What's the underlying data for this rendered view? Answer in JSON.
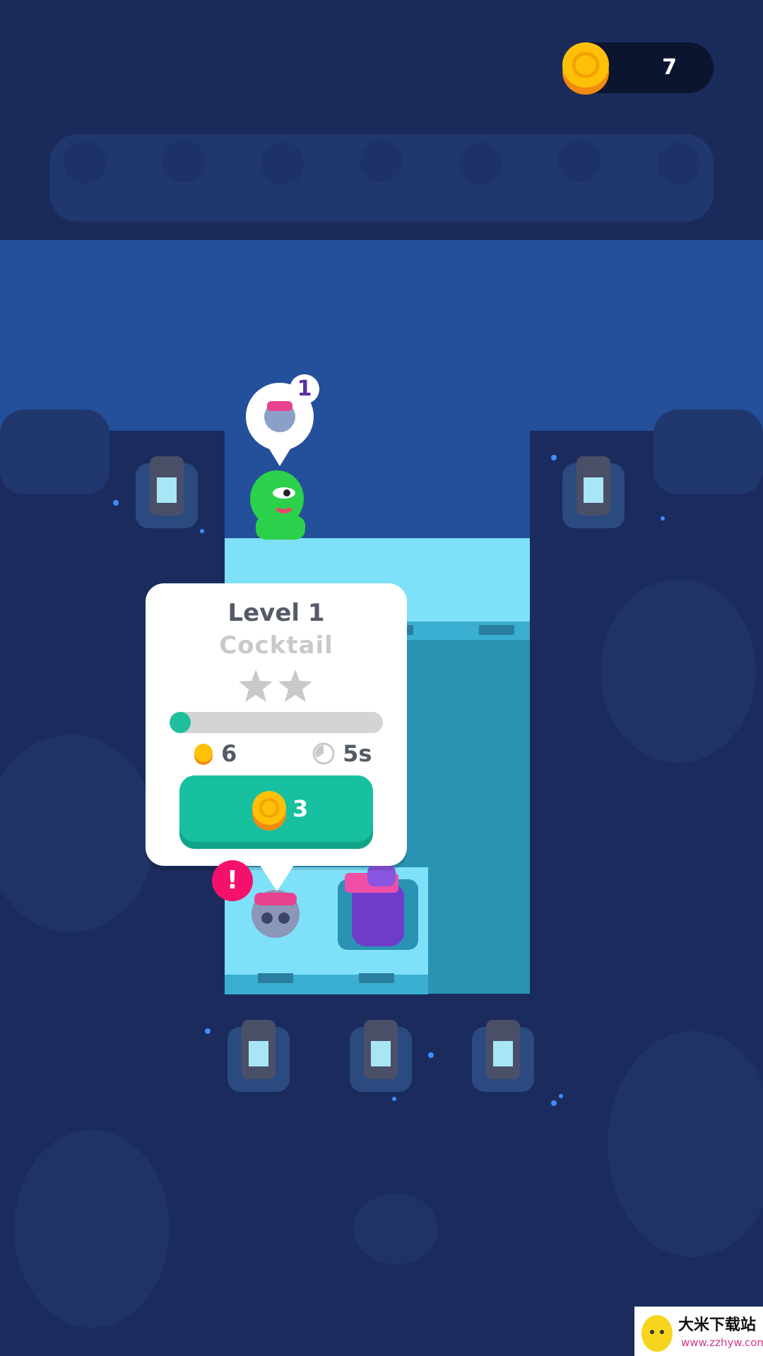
{
  "hud": {
    "coins": "7"
  },
  "order_bubble": {
    "count": "1",
    "item_icon": "skull-cocktail-icon"
  },
  "station_popup": {
    "level_label": "Level 1",
    "item_name": "Cocktail",
    "stars_total": 2,
    "stars_filled": 0,
    "progress": 0.1,
    "reward_coins": "6",
    "time_label": "5s",
    "upgrade_cost": "3"
  },
  "alert_badge": {
    "label": "!"
  },
  "watermark": {
    "site_name": "大米下载站",
    "url": "www.zzhyw.com"
  },
  "colors": {
    "background": "#1a2a5c",
    "floor_light": "#7fe0fa",
    "floor_dark": "#2a93b4",
    "accent_green": "#17c09e",
    "coin_gold": "#ffc107",
    "alert_pink": "#f5106b"
  }
}
